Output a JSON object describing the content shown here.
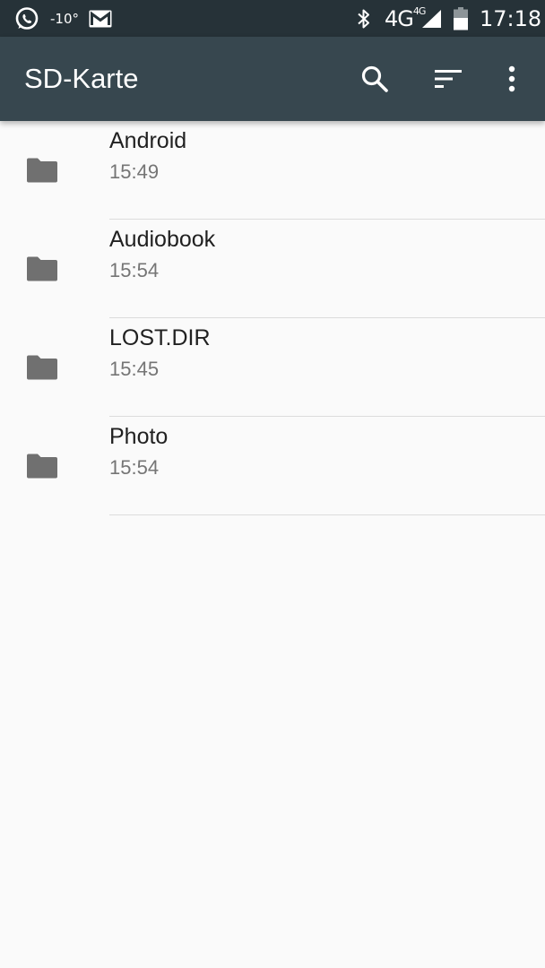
{
  "status_bar": {
    "temperature": "-10°",
    "network": "4G",
    "network_small": "4G",
    "time": "17:18",
    "icons": [
      "whatsapp-icon",
      "gmail-icon",
      "bluetooth-icon",
      "signal-icon",
      "battery-icon"
    ]
  },
  "app_bar": {
    "title": "SD-Karte",
    "background": "#37474f",
    "actions": [
      "search-icon",
      "sort-icon",
      "more-vert-icon"
    ]
  },
  "files": [
    {
      "name": "Android",
      "time": "15:49",
      "icon": "folder-icon"
    },
    {
      "name": "Audiobook",
      "time": "15:54",
      "icon": "folder-icon"
    },
    {
      "name": "LOST.DIR",
      "time": "15:45",
      "icon": "folder-icon"
    },
    {
      "name": "Photo",
      "time": "15:54",
      "icon": "folder-icon"
    }
  ]
}
